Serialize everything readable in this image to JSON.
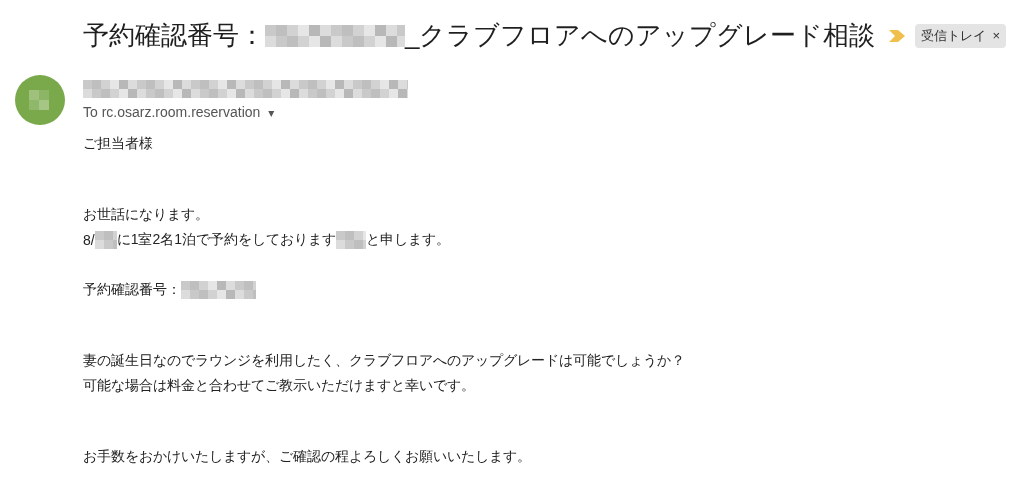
{
  "subject": [
    {
      "kind": "text",
      "text": "予約確認番号："
    },
    {
      "kind": "redacted"
    },
    {
      "kind": "text",
      "text": "_クラブフロアへのアップグレード相談"
    }
  ],
  "label": {
    "text": "受信トレイ",
    "close": "×"
  },
  "sender": {
    "to": "To rc.osarz.room.reservation",
    "caret": "▾"
  },
  "body": [
    [
      [
        {
          "kind": "text",
          "text": "ご担当者様"
        }
      ]
    ],
    [
      [
        {
          "kind": "text",
          "text": "お世話になります。"
        }
      ],
      [
        {
          "kind": "text",
          "text": "8/"
        },
        {
          "kind": "redacted"
        },
        {
          "kind": "text",
          "text": "に1室2名1泊で予約をしております"
        },
        {
          "kind": "redacted"
        },
        {
          "kind": "text",
          "text": "と申します。"
        }
      ]
    ],
    [
      [
        {
          "kind": "text",
          "text": "予約確認番号："
        },
        {
          "kind": "redacted"
        }
      ]
    ],
    [
      [
        {
          "kind": "text",
          "text": "妻の誕生日なのでラウンジを利用したく、クラブフロアへのアップグレードは可能でしょうか？"
        }
      ],
      [
        {
          "kind": "text",
          "text": "可能な場合は料金と合わせてご教示いただけますと幸いです。"
        }
      ]
    ],
    [
      [
        {
          "kind": "text",
          "text": "お手数をおかけいたしますが、ご確認の程よろしくお願いいたします。"
        }
      ]
    ]
  ]
}
